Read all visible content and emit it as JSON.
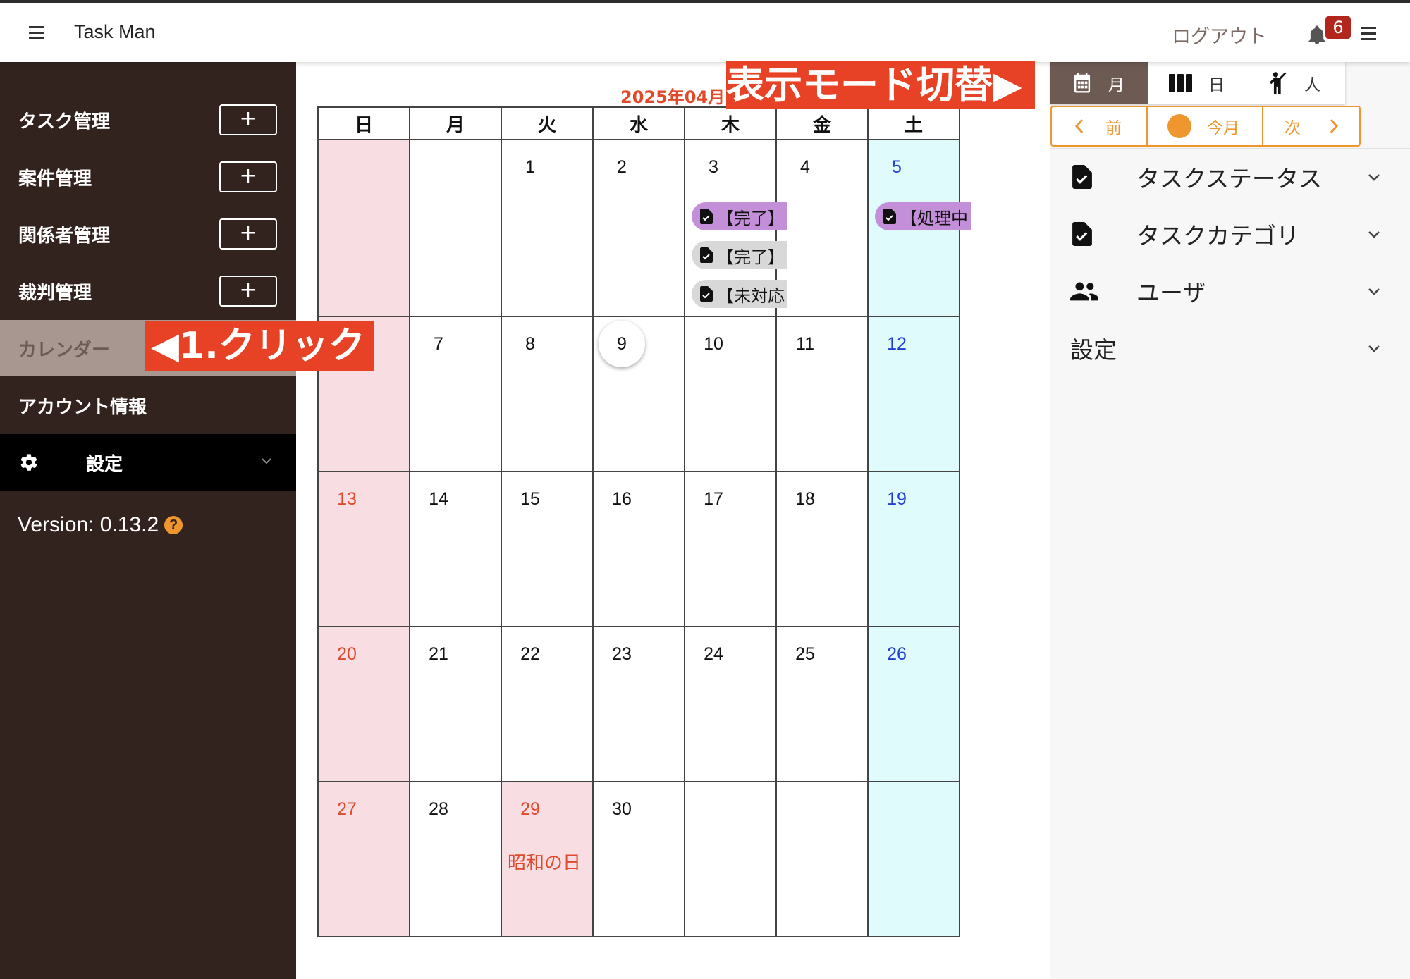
{
  "header": {
    "app_title": "Task Man",
    "logout_label": "ログアウト",
    "notification_count": "6"
  },
  "sidebar": {
    "items": [
      {
        "label": "タスク管理",
        "add": "+"
      },
      {
        "label": "案件管理",
        "add": "+"
      },
      {
        "label": "関係者管理",
        "add": "+"
      },
      {
        "label": "裁判管理",
        "add": "+"
      },
      {
        "label": "カレンダー"
      },
      {
        "label": "アカウント情報"
      },
      {
        "label": "設定"
      }
    ],
    "version_label": "Version: 0.13.2",
    "help_glyph": "?"
  },
  "annotations": {
    "click": "◀1.クリック",
    "mode_switch": "表示モード切替▶"
  },
  "calendar": {
    "month_label": "2025年04月",
    "weekdays": [
      "日",
      "月",
      "火",
      "水",
      "木",
      "金",
      "土"
    ],
    "days": {
      "d1": "1",
      "d2": "2",
      "d3": "3",
      "d4": "4",
      "d5": "5",
      "d7": "7",
      "d8": "8",
      "d9": "9",
      "d10": "10",
      "d11": "11",
      "d12": "12",
      "d13": "13",
      "d14": "14",
      "d15": "15",
      "d16": "16",
      "d17": "17",
      "d18": "18",
      "d19": "19",
      "d20": "20",
      "d21": "21",
      "d22": "22",
      "d23": "23",
      "d24": "24",
      "d25": "25",
      "d26": "26",
      "d27": "27",
      "d28": "28",
      "d29": "29",
      "d30": "30"
    },
    "today": "9",
    "holiday_29": "昭和の日",
    "events": {
      "thu3_a": "【完了】",
      "thu3_b": "【完了】",
      "thu3_c": "【未対応",
      "sat5_a": "【処理中"
    }
  },
  "right_panel": {
    "view_modes": {
      "month": "月",
      "day": "日",
      "person": "人"
    },
    "nav": {
      "prev": "前",
      "today": "今月",
      "next": "次"
    },
    "filters": {
      "task_status": "タスクステータス",
      "task_category": "タスクカテゴリ",
      "user": "ユーザ",
      "settings": "設定"
    }
  },
  "colors": {
    "sidebar_bg": "#33231f",
    "active_item_bg": "#a89791",
    "accent_orange": "#f0962f",
    "callout_red": "#e84226",
    "sunday_bg": "#f8dde3",
    "saturday_bg": "#e0fbfc",
    "event_done": "#c38fd8",
    "event_pending": "#d8d8d8"
  }
}
